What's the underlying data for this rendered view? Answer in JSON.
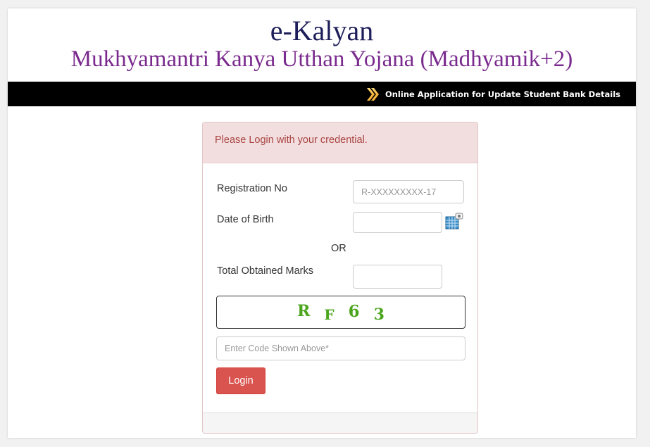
{
  "header": {
    "title": "e-Kalyan",
    "subtitle": "Mukhyamantri Kanya Utthan Yojana (Madhyamik+2)",
    "bar_link": "Online Application for Update Student Bank Details",
    "bar_icon": "orange-double-arrow-icon"
  },
  "login": {
    "heading": "Please Login with your credential.",
    "registration_label": "Registration No",
    "registration_placeholder": "R-XXXXXXXXX-17",
    "registration_value": "",
    "dob_label": "Date of Birth",
    "dob_value": "",
    "calendar_icon": "calendar-icon",
    "or_text": "OR",
    "marks_label": "Total Obtained Marks",
    "marks_value": "",
    "captcha_chars": [
      "R",
      "F",
      "6",
      "3"
    ],
    "captcha_placeholder": "Enter Code Shown Above*",
    "captcha_value": "",
    "login_button": "Login"
  },
  "colors": {
    "title": "#1e1e5a",
    "subtitle": "#7a2a8e",
    "bar_background": "#000000",
    "heading_background": "#f2dede",
    "heading_text": "#a94442",
    "button_background": "#d9534f",
    "captcha_text": "#4aa51d"
  }
}
